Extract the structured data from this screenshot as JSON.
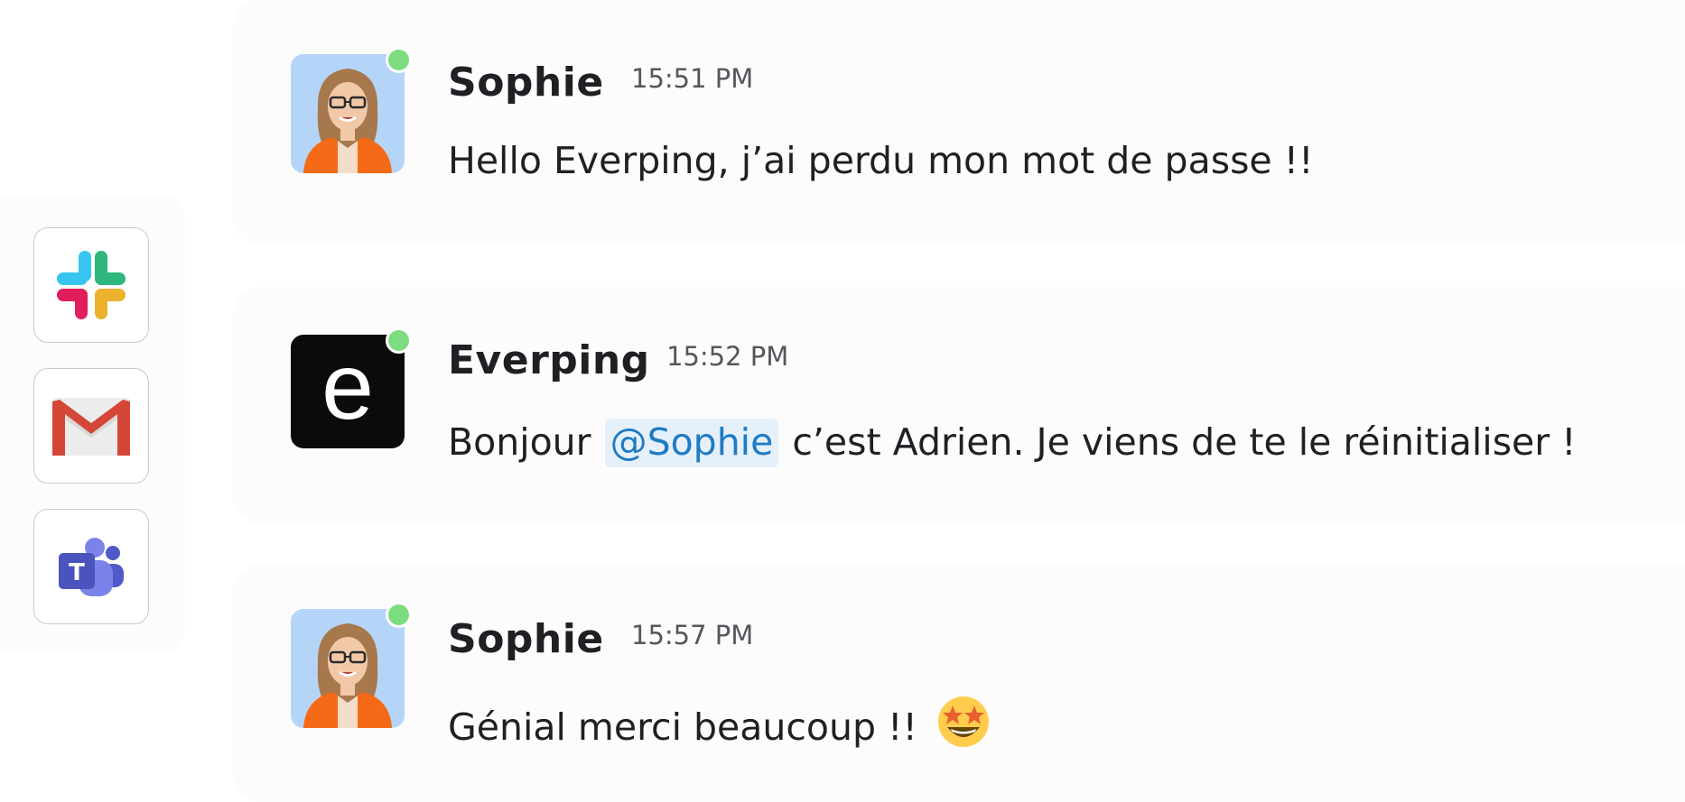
{
  "apps": [
    {
      "name": "slack-icon"
    },
    {
      "name": "gmail-icon"
    },
    {
      "name": "teams-icon"
    }
  ],
  "messages": [
    {
      "sender": "Sophie",
      "time": "15:51 PM",
      "text": "Hello Everping, j’ai perdu mon mot de passe !!",
      "avatar": "sophie-avatar",
      "online": true
    },
    {
      "sender": "Everping",
      "time": "15:52 PM",
      "text_before": "Bonjour",
      "mention": "@Sophie",
      "text_after": "c’est Adrien. Je viens de te le réinitialiser !",
      "avatar": "everping-logo",
      "avatar_letter": "e",
      "online": true
    },
    {
      "sender": "Sophie",
      "time": "15:57 PM",
      "text": "Génial merci beaucoup !!",
      "emoji": "star-struck-emoji",
      "avatar": "sophie-avatar",
      "online": true
    }
  ],
  "colors": {
    "presence": "#7ddc7f",
    "mention_bg": "#e6f0fa",
    "mention_text": "#1f7bc4"
  }
}
